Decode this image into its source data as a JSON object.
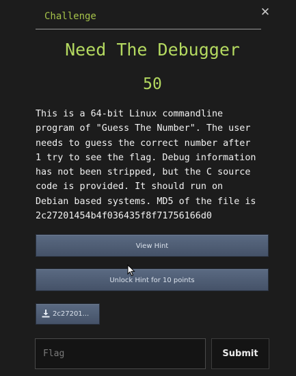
{
  "tab": {
    "label": "Challenge",
    "close_icon": "close-icon"
  },
  "challenge": {
    "name": "Need The Debugger",
    "points": "50",
    "description_lines": [
      "This is a 64-bit Linux commandline",
      "program of \"Guess The Number\". The user",
      "needs to guess the correct number after",
      "1 try to see the flag. Debug information",
      "has not been stripped, but the C source",
      "code is provided. It should run on",
      "Debian based systems. MD5 of the file is",
      "2c27201454b4f036435f8f71756166d0"
    ]
  },
  "buttons": {
    "view_hint": "View Hint",
    "unlock_hint": "Unlock Hint for 10 points",
    "file_download": "2c27201...",
    "file_icon": "download-icon",
    "submit": "Submit"
  },
  "flag_input": {
    "placeholder": "Flag",
    "value": ""
  },
  "colors": {
    "accent": "#b4d960",
    "button": "#4f5d74",
    "background": "#1c1c1c"
  }
}
